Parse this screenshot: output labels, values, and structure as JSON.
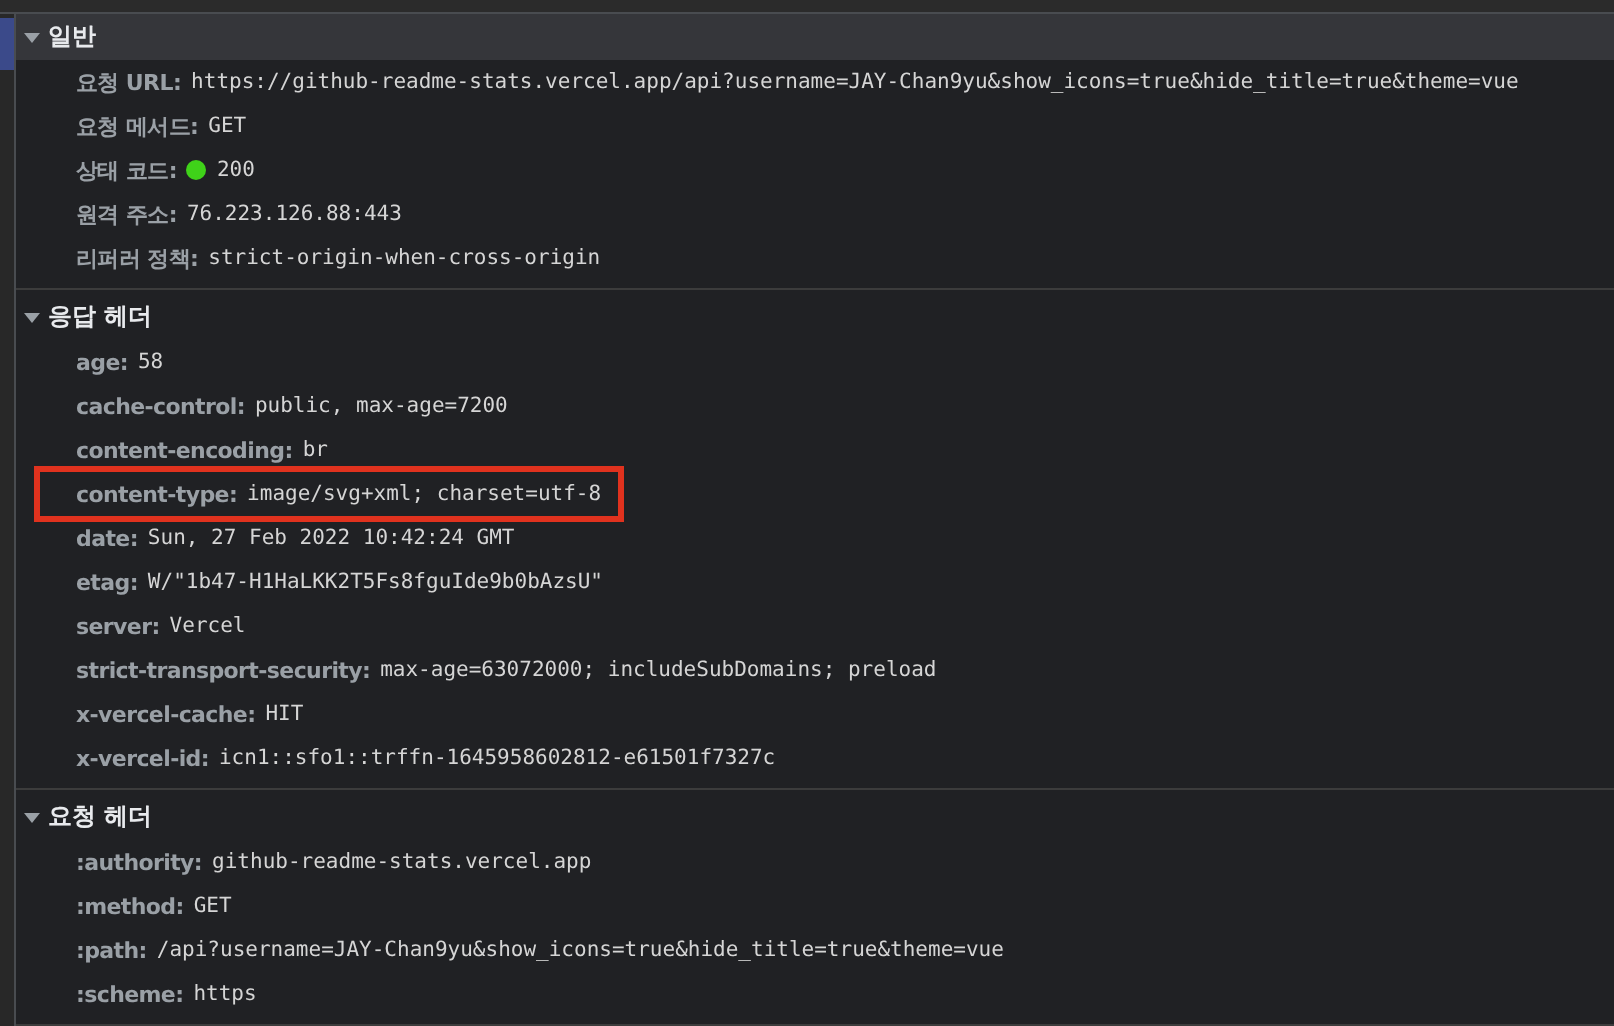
{
  "sections": [
    {
      "title": "일반",
      "expanded": true,
      "selected": true,
      "rows": [
        {
          "name": "요청 URL:",
          "value": "https://github-readme-stats.vercel.app/api?username=JAY-Chan9yu&show_icons=true&hide_title=true&theme=vue",
          "highlighted": false
        },
        {
          "name": "요청 메서드:",
          "value": "GET",
          "highlighted": false
        },
        {
          "name": "상태 코드:",
          "value": "200",
          "color": "#3fd219",
          "highlighted": false
        },
        {
          "name": "원격 주소:",
          "value": "76.223.126.88:443",
          "highlighted": false
        },
        {
          "name": "리퍼러 정책:",
          "value": "strict-origin-when-cross-origin",
          "highlighted": false
        }
      ]
    },
    {
      "title": "응답 헤더",
      "expanded": true,
      "selected": false,
      "rows": [
        {
          "name": "age:",
          "value": "58",
          "highlighted": false
        },
        {
          "name": "cache-control:",
          "value": "public, max-age=7200",
          "highlighted": false
        },
        {
          "name": "content-encoding:",
          "value": "br",
          "highlighted": false
        },
        {
          "name": "content-type:",
          "value": "image/svg+xml; charset=utf-8",
          "highlighted": true
        },
        {
          "name": "date:",
          "value": "Sun, 27 Feb 2022 10:42:24 GMT",
          "highlighted": false
        },
        {
          "name": "etag:",
          "value": "W/\"1b47-H1HaLKK2T5Fs8fguIde9b0bAzsU\"",
          "highlighted": false
        },
        {
          "name": "server:",
          "value": "Vercel",
          "highlighted": false
        },
        {
          "name": "strict-transport-security:",
          "value": "max-age=63072000; includeSubDomains; preload",
          "highlighted": false
        },
        {
          "name": "x-vercel-cache:",
          "value": "HIT",
          "highlighted": false
        },
        {
          "name": "x-vercel-id:",
          "value": "icn1::sfo1::trffn-1645958602812-e61501f7327c",
          "highlighted": false
        }
      ]
    },
    {
      "title": "요청 헤더",
      "expanded": true,
      "selected": false,
      "rows": [
        {
          "name": ":authority:",
          "value": "github-readme-stats.vercel.app",
          "highlighted": false
        },
        {
          "name": ":method:",
          "value": "GET",
          "highlighted": false
        },
        {
          "name": ":path:",
          "value": "/api?username=JAY-Chan9yu&show_icons=true&hide_title=true&theme=vue",
          "highlighted": false
        },
        {
          "name": ":scheme:",
          "value": "https",
          "highlighted": false
        }
      ]
    }
  ]
}
